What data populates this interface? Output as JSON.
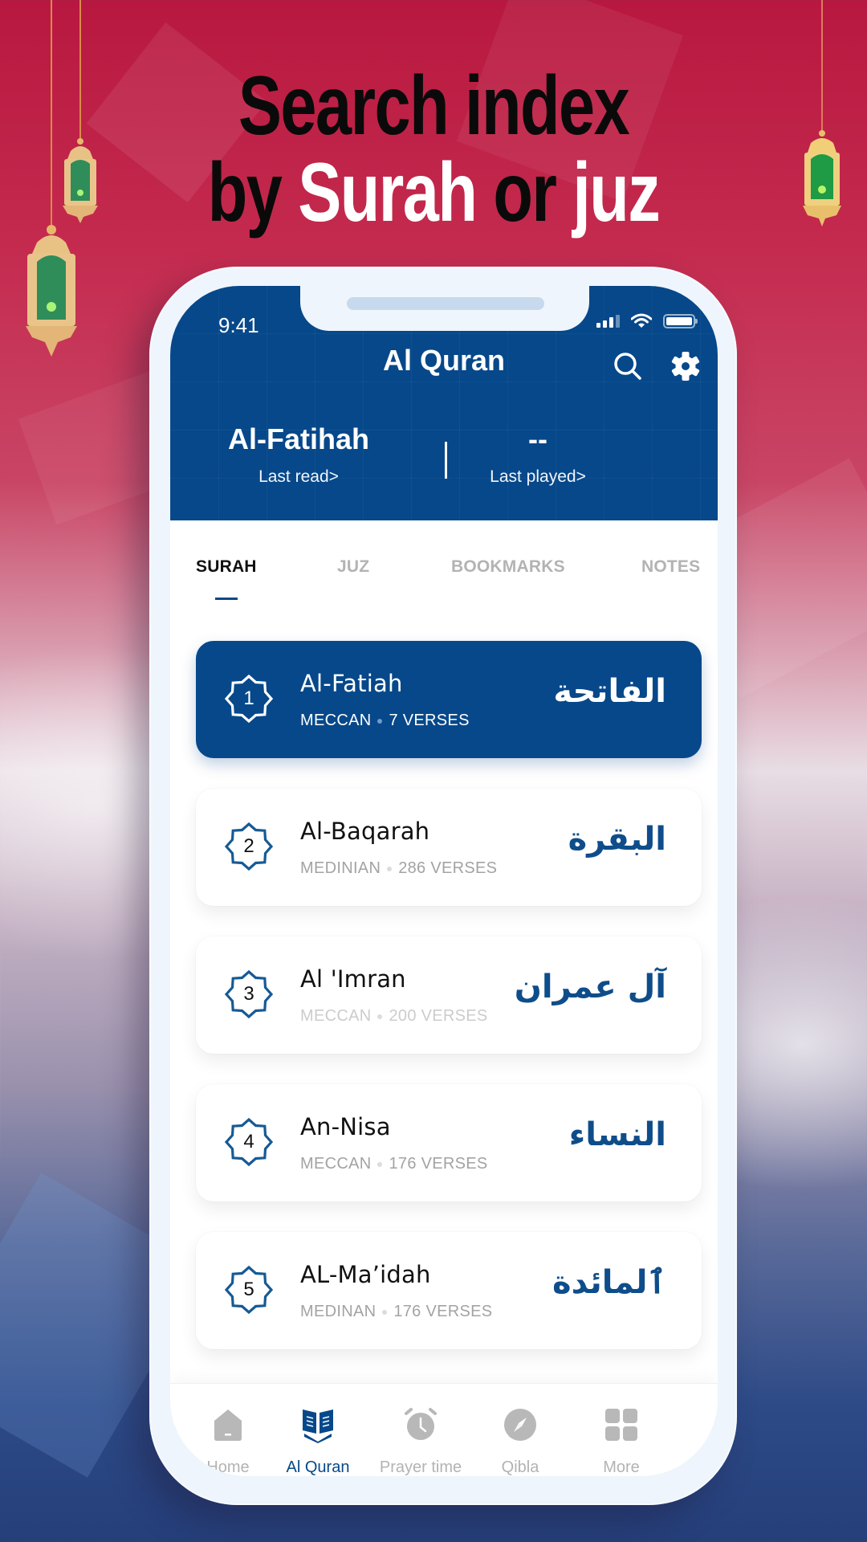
{
  "headline": {
    "line1": "Search index",
    "line2_prefix": "by ",
    "line2_highlight": "Surah",
    "line2_middle": " or ",
    "line2_end": "juz"
  },
  "status_bar": {
    "time": "9:41",
    "icons": [
      "signal-icon",
      "wifi-icon",
      "battery-icon"
    ]
  },
  "header": {
    "title": "Al Quran",
    "icons": [
      "search-icon",
      "gear-icon"
    ],
    "last_read": {
      "value": "Al-Fatihah",
      "label": "Last read>"
    },
    "last_played": {
      "value": "--",
      "label": "Last played>"
    }
  },
  "tabs": [
    {
      "label": "SURAH",
      "active": true
    },
    {
      "label": "JUZ",
      "active": false
    },
    {
      "label": "BOOKMARKS",
      "active": false
    },
    {
      "label": "NOTES",
      "active": false
    }
  ],
  "surahs": [
    {
      "number": "1",
      "name": "Al-Fatiah",
      "origin": "MECCAN",
      "verses": "7 VERSES",
      "arabic": "الفاتحة",
      "active": true
    },
    {
      "number": "2",
      "name": "Al-Baqarah",
      "origin": "MEDINIAN",
      "verses": "286 VERSES",
      "arabic": "البقرة",
      "active": false
    },
    {
      "number": "3",
      "name": "Al 'Imran",
      "origin": "MECCAN",
      "verses": "200 VERSES",
      "arabic": "آل عمران",
      "active": false
    },
    {
      "number": "4",
      "name": "An-Nisa",
      "origin": "MECCAN",
      "verses": "176 VERSES",
      "arabic": "النساء",
      "active": false
    },
    {
      "number": "5",
      "name": "AL-Ma’idah",
      "origin": "MEDINAN",
      "verses": "176 VERSES",
      "arabic": "ٱلمائدة",
      "active": false
    }
  ],
  "bottom_nav": [
    {
      "label": "Home",
      "icon": "home-icon",
      "active": false
    },
    {
      "label": "Al Quran",
      "icon": "quran-book-icon",
      "active": true
    },
    {
      "label": "Prayer time",
      "icon": "alarm-clock-icon",
      "active": false
    },
    {
      "label": "Qibla",
      "icon": "compass-icon",
      "active": false
    },
    {
      "label": "More",
      "icon": "grid-icon",
      "active": false
    }
  ],
  "colors": {
    "primary": "#06488a",
    "background_top": "#b8183f",
    "background_bottom": "#253f7a",
    "inactive": "#b3b3b3",
    "lantern_gold": "#e6b86a",
    "lantern_glass": "#2e8b57"
  }
}
